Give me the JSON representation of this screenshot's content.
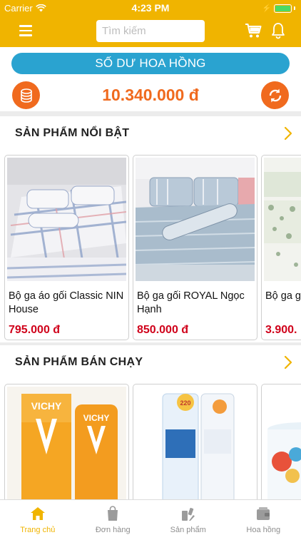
{
  "status_bar": {
    "carrier": "Carrier",
    "time": "4:23 PM"
  },
  "nav": {
    "search_placeholder": "Tìm kiếm",
    "search_value": ""
  },
  "balance": {
    "button_label": "SỐ DƯ HOA HỒNG",
    "amount": "10.340.000 đ"
  },
  "featured": {
    "title": "SẢN PHẨM NỔI BẬT",
    "products": [
      {
        "name": "Bộ ga áo gối Classic NIN House",
        "price": "795.000 đ"
      },
      {
        "name": "Bộ ga gối ROYAL Ngọc Hạnh",
        "price": "850.000 đ"
      },
      {
        "name": "Bộ ga gối Store N",
        "price": "3.900."
      }
    ]
  },
  "best_selling": {
    "title": "SẢN PHẨM BÁN CHẠY",
    "products": [
      {
        "image_text": "VICHY"
      },
      {
        "image_text": "220"
      },
      {
        "image_text": ""
      }
    ]
  },
  "tabs": [
    {
      "label": "Trang chủ",
      "icon": "home-icon",
      "active": true
    },
    {
      "label": "Đơn hàng",
      "icon": "shopping-bag-icon",
      "active": false
    },
    {
      "label": "Sản phẩm",
      "icon": "products-icon",
      "active": false
    },
    {
      "label": "Hoa hồng",
      "icon": "wallet-icon",
      "active": false
    }
  ],
  "colors": {
    "brand": "#f0b400",
    "accent": "#f06a1e",
    "info": "#2aa3d0",
    "price": "#d0021b"
  }
}
